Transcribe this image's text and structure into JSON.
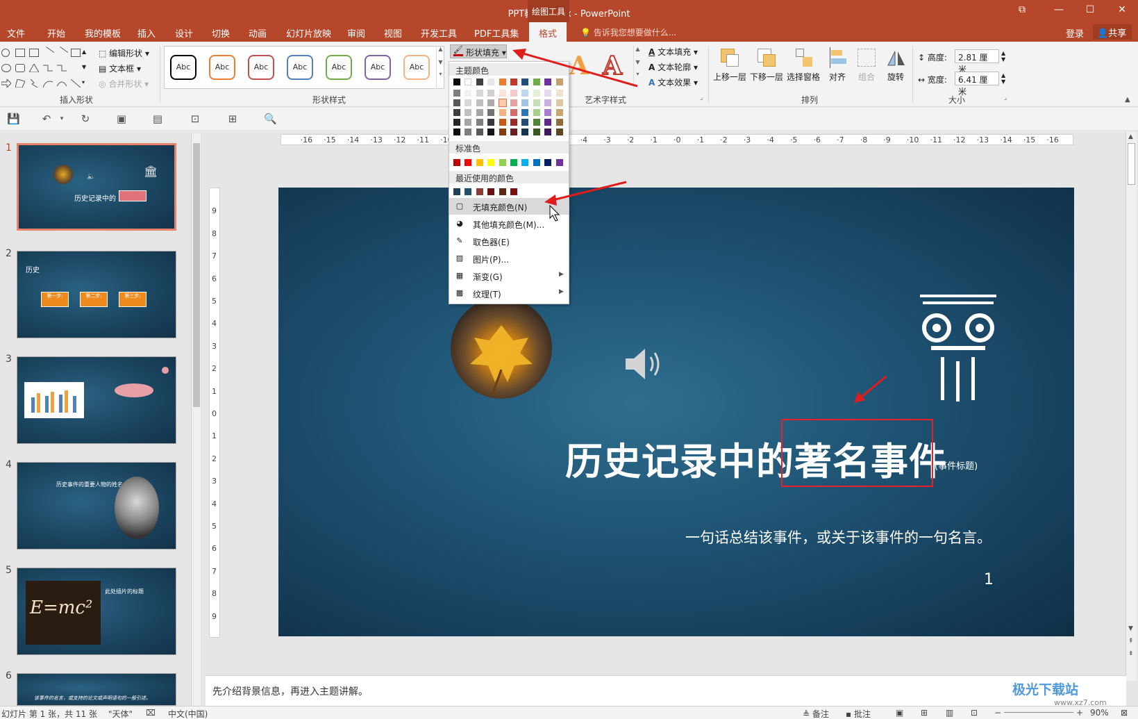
{
  "window": {
    "title": "PPT教程2.pptx - PowerPoint",
    "context_tab_group": "绘图工具",
    "min_label": "—",
    "restore_label": "☐",
    "close_label": "✕",
    "ribbon_display_label": "⧉"
  },
  "menu": {
    "tabs": [
      "文件",
      "开始",
      "我的模板",
      "插入",
      "设计",
      "切换",
      "动画",
      "幻灯片放映",
      "审阅",
      "视图",
      "开发工具",
      "PDF工具集",
      "格式"
    ],
    "active_tab": "格式",
    "tell_me": "告诉我您想要做什么...",
    "login": "登录",
    "share": "共享"
  },
  "ribbon": {
    "insert_shapes": {
      "label": "插入形状",
      "edit_shape": "编辑形状",
      "text_box": "文本框",
      "merge_shapes": "合并形状"
    },
    "shape_styles": {
      "label": "形状样式",
      "preset_text": "Abc",
      "preset_colors": [
        "#000000",
        "#ed7d31",
        "#c0504d",
        "#4f81bd",
        "#70ad47",
        "#8064a2",
        "#f4b183"
      ],
      "shape_fill": "形状填充"
    },
    "art_styles": {
      "label": "艺术字样式",
      "text_fill": "文本填充",
      "text_outline": "文本轮廓",
      "text_effects": "文本效果",
      "letter": "A"
    },
    "arrange": {
      "label": "排列",
      "bring_forward": "上移一层",
      "send_backward": "下移一层",
      "selection_pane": "选择窗格",
      "align": "对齐",
      "group": "组合",
      "rotate": "旋转"
    },
    "size": {
      "label": "大小",
      "height_label": "高度:",
      "height_value": "2.81 厘米",
      "width_label": "宽度:",
      "width_value": "6.41 厘米"
    }
  },
  "fill_dropdown": {
    "theme_colors_label": "主题颜色",
    "theme_top_row": [
      "#000000",
      "#ffffff",
      "#404040",
      "#e7e6e6",
      "#ed7d31",
      "#c0392b",
      "#1f4e79",
      "#70ad47",
      "#7030a0",
      "#c5a06e"
    ],
    "theme_shades": [
      [
        "#7f7f7f",
        "#f2f2f2",
        "#d8d8d8",
        "#d0cece",
        "#fbe4d5",
        "#f4cccc",
        "#bdd7ee",
        "#e2efda",
        "#e4d7f0",
        "#efe3cf"
      ],
      [
        "#595959",
        "#d8d8d8",
        "#bfbfbf",
        "#aeaaaa",
        "#f8cbad",
        "#e6a2a2",
        "#9dc3e6",
        "#c5e0b4",
        "#c9b0e0",
        "#dfc8a0"
      ],
      [
        "#3f3f3f",
        "#bfbfbf",
        "#a5a5a5",
        "#757171",
        "#f4b183",
        "#d46a6a",
        "#2e75b6",
        "#a9d18e",
        "#a87fd0",
        "#c9a56e"
      ],
      [
        "#262626",
        "#a5a5a5",
        "#7f7f7f",
        "#3a3838",
        "#c55a11",
        "#9b2c2c",
        "#1f4e79",
        "#548235",
        "#5b2a8a",
        "#8e6b3c"
      ],
      [
        "#0d0d0d",
        "#7f7f7f",
        "#595959",
        "#171616",
        "#833c0b",
        "#6b1e1e",
        "#14334f",
        "#375623",
        "#3b1a5a",
        "#5e4627"
      ]
    ],
    "standard_colors_label": "标准色",
    "standard_colors": [
      "#c00000",
      "#ff0000",
      "#ffc000",
      "#ffff00",
      "#92d050",
      "#00b050",
      "#00b0f0",
      "#0070c0",
      "#002060",
      "#7030a0"
    ],
    "recent_colors_label": "最近使用的颜色",
    "recent_colors": [
      "#1f3f58",
      "#254f6e",
      "#8c3b3b",
      "#6b1010",
      "#5a2a0f",
      "#7a1010"
    ],
    "items": [
      {
        "label": "无填充颜色(N)",
        "icon": "no-fill-icon",
        "submenu": false
      },
      {
        "label": "其他填充颜色(M)...",
        "icon": "color-wheel-icon",
        "submenu": false
      },
      {
        "label": "取色器(E)",
        "icon": "eyedropper-icon",
        "submenu": false
      },
      {
        "label": "图片(P)...",
        "icon": "picture-icon",
        "submenu": false
      },
      {
        "label": "渐变(G)",
        "icon": "gradient-icon",
        "submenu": true
      },
      {
        "label": "纹理(T)",
        "icon": "texture-icon",
        "submenu": true
      }
    ]
  },
  "thumbnails": [
    {
      "num": "1",
      "title": "历史记录中的",
      "selected": true
    },
    {
      "num": "2",
      "title": "历史",
      "steps": [
        "第一步:",
        "第二步:",
        "第三步:"
      ],
      "selected": false
    },
    {
      "num": "3",
      "title": "",
      "selected": false
    },
    {
      "num": "4",
      "title": "历史事件的重要人物的姓名",
      "selected": false
    },
    {
      "num": "5",
      "title": "此处插片的标题",
      "formula": "E=mc²",
      "selected": false
    },
    {
      "num": "6",
      "title": "该事件的名言，或支持的论文或声明语句的一般引述。",
      "selected": false
    }
  ],
  "rulers": {
    "horizontal": [
      "16",
      "15",
      "14",
      "13",
      "12",
      "11",
      "10",
      "9",
      "8",
      "7",
      "6",
      "5",
      "4",
      "3",
      "2",
      "1",
      "0",
      "1",
      "2",
      "3",
      "4",
      "5",
      "6",
      "7",
      "8",
      "9",
      "10",
      "11",
      "12",
      "13",
      "14",
      "15",
      "16"
    ],
    "vertical": [
      "9",
      "8",
      "7",
      "6",
      "5",
      "4",
      "3",
      "2",
      "1",
      "0",
      "1",
      "2",
      "3",
      "4",
      "5",
      "6",
      "7",
      "8",
      "9"
    ]
  },
  "slide": {
    "title": "历史记录中的著名事件",
    "title_note": "(事件标题)",
    "subtitle": "一句话总结该事件，或关于该事件的一句名言。",
    "page_number": "1"
  },
  "notes": {
    "text": "先介绍背景信息，再进入主题讲解。"
  },
  "status": {
    "slide_info": "幻灯片 第 1 张，共 11 张",
    "theme": "\"天体\"",
    "language": "中文(中国)",
    "notes": "备注",
    "comments": "批注",
    "zoom": "90%"
  },
  "watermark": {
    "brand": "极光下载站",
    "site": "www.xz7.com"
  },
  "colors": {
    "accent": "#b7472a",
    "selection": "#e8202a",
    "slide_bg": "#1f5474"
  }
}
